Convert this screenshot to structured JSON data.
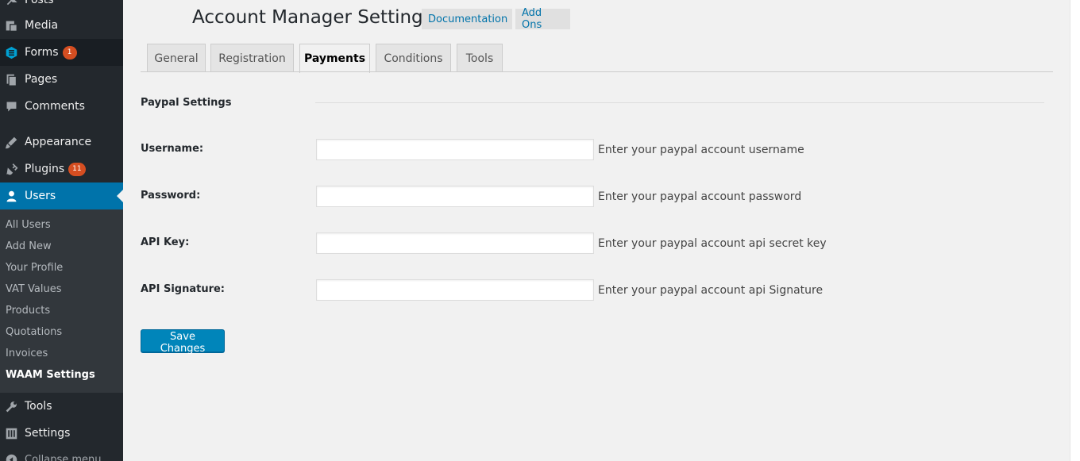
{
  "sidebar": {
    "menu": [
      {
        "label": "Posts",
        "icon": "pin-icon"
      },
      {
        "label": "Media",
        "icon": "media-icon"
      },
      {
        "label": "Forms",
        "icon": "forms-icon",
        "badge": "1"
      },
      {
        "label": "Pages",
        "icon": "pages-icon"
      },
      {
        "label": "Comments",
        "icon": "comments-icon"
      },
      {
        "label": "Appearance",
        "icon": "appearance-icon"
      },
      {
        "label": "Plugins",
        "icon": "plugins-icon",
        "badge": "11"
      },
      {
        "label": "Users",
        "icon": "users-icon"
      },
      {
        "label": "Tools",
        "icon": "tools-icon"
      },
      {
        "label": "Settings",
        "icon": "settings-icon"
      },
      {
        "label": "Collapse menu",
        "icon": "collapse-icon"
      }
    ],
    "submenu": [
      "All Users",
      "Add New",
      "Your Profile",
      "VAT Values",
      "Products",
      "Quotations",
      "Invoices",
      "WAAM Settings"
    ]
  },
  "header": {
    "title": "Account Manager Settings",
    "documentation": "Documentation",
    "addons": "Add Ons"
  },
  "tabs": [
    "General",
    "Registration",
    "Payments",
    "Conditions",
    "Tools"
  ],
  "section": {
    "title": "Paypal Settings",
    "fields": [
      {
        "label": "Username:",
        "value": "",
        "description": "Enter your paypal account username"
      },
      {
        "label": "Password:",
        "value": "",
        "description": "Enter your paypal account password"
      },
      {
        "label": "API Key:",
        "value": "",
        "description": "Enter your paypal account api secret key"
      },
      {
        "label": "API Signature:",
        "value": "",
        "description": "Enter your paypal account api Signature"
      }
    ]
  },
  "save_label": "Save Changes",
  "colors": {
    "sidebar_bg": "#23282d",
    "active": "#0073aa",
    "badge": "#d54e21",
    "button": "#0085ba"
  }
}
